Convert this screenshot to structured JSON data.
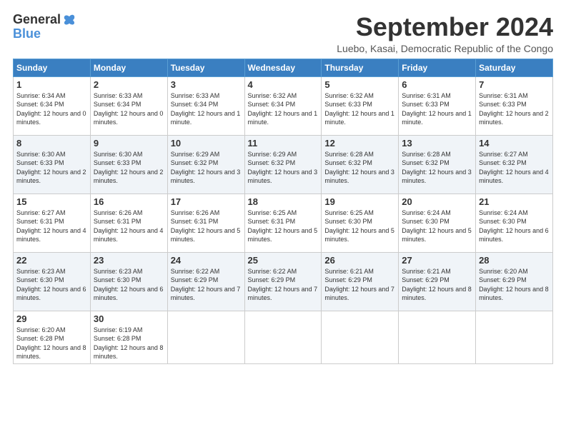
{
  "header": {
    "logo_general": "General",
    "logo_blue": "Blue",
    "month_title": "September 2024",
    "location": "Luebo, Kasai, Democratic Republic of the Congo"
  },
  "weekdays": [
    "Sunday",
    "Monday",
    "Tuesday",
    "Wednesday",
    "Thursday",
    "Friday",
    "Saturday"
  ],
  "weeks": [
    [
      {
        "day": "1",
        "sunrise": "6:34 AM",
        "sunset": "6:34 PM",
        "daylight": "12 hours and 0 minutes."
      },
      {
        "day": "2",
        "sunrise": "6:33 AM",
        "sunset": "6:34 PM",
        "daylight": "12 hours and 0 minutes."
      },
      {
        "day": "3",
        "sunrise": "6:33 AM",
        "sunset": "6:34 PM",
        "daylight": "12 hours and 1 minute."
      },
      {
        "day": "4",
        "sunrise": "6:32 AM",
        "sunset": "6:34 PM",
        "daylight": "12 hours and 1 minute."
      },
      {
        "day": "5",
        "sunrise": "6:32 AM",
        "sunset": "6:33 PM",
        "daylight": "12 hours and 1 minute."
      },
      {
        "day": "6",
        "sunrise": "6:31 AM",
        "sunset": "6:33 PM",
        "daylight": "12 hours and 1 minute."
      },
      {
        "day": "7",
        "sunrise": "6:31 AM",
        "sunset": "6:33 PM",
        "daylight": "12 hours and 2 minutes."
      }
    ],
    [
      {
        "day": "8",
        "sunrise": "6:30 AM",
        "sunset": "6:33 PM",
        "daylight": "12 hours and 2 minutes."
      },
      {
        "day": "9",
        "sunrise": "6:30 AM",
        "sunset": "6:33 PM",
        "daylight": "12 hours and 2 minutes."
      },
      {
        "day": "10",
        "sunrise": "6:29 AM",
        "sunset": "6:32 PM",
        "daylight": "12 hours and 3 minutes."
      },
      {
        "day": "11",
        "sunrise": "6:29 AM",
        "sunset": "6:32 PM",
        "daylight": "12 hours and 3 minutes."
      },
      {
        "day": "12",
        "sunrise": "6:28 AM",
        "sunset": "6:32 PM",
        "daylight": "12 hours and 3 minutes."
      },
      {
        "day": "13",
        "sunrise": "6:28 AM",
        "sunset": "6:32 PM",
        "daylight": "12 hours and 3 minutes."
      },
      {
        "day": "14",
        "sunrise": "6:27 AM",
        "sunset": "6:32 PM",
        "daylight": "12 hours and 4 minutes."
      }
    ],
    [
      {
        "day": "15",
        "sunrise": "6:27 AM",
        "sunset": "6:31 PM",
        "daylight": "12 hours and 4 minutes."
      },
      {
        "day": "16",
        "sunrise": "6:26 AM",
        "sunset": "6:31 PM",
        "daylight": "12 hours and 4 minutes."
      },
      {
        "day": "17",
        "sunrise": "6:26 AM",
        "sunset": "6:31 PM",
        "daylight": "12 hours and 5 minutes."
      },
      {
        "day": "18",
        "sunrise": "6:25 AM",
        "sunset": "6:31 PM",
        "daylight": "12 hours and 5 minutes."
      },
      {
        "day": "19",
        "sunrise": "6:25 AM",
        "sunset": "6:30 PM",
        "daylight": "12 hours and 5 minutes."
      },
      {
        "day": "20",
        "sunrise": "6:24 AM",
        "sunset": "6:30 PM",
        "daylight": "12 hours and 5 minutes."
      },
      {
        "day": "21",
        "sunrise": "6:24 AM",
        "sunset": "6:30 PM",
        "daylight": "12 hours and 6 minutes."
      }
    ],
    [
      {
        "day": "22",
        "sunrise": "6:23 AM",
        "sunset": "6:30 PM",
        "daylight": "12 hours and 6 minutes."
      },
      {
        "day": "23",
        "sunrise": "6:23 AM",
        "sunset": "6:30 PM",
        "daylight": "12 hours and 6 minutes."
      },
      {
        "day": "24",
        "sunrise": "6:22 AM",
        "sunset": "6:29 PM",
        "daylight": "12 hours and 7 minutes."
      },
      {
        "day": "25",
        "sunrise": "6:22 AM",
        "sunset": "6:29 PM",
        "daylight": "12 hours and 7 minutes."
      },
      {
        "day": "26",
        "sunrise": "6:21 AM",
        "sunset": "6:29 PM",
        "daylight": "12 hours and 7 minutes."
      },
      {
        "day": "27",
        "sunrise": "6:21 AM",
        "sunset": "6:29 PM",
        "daylight": "12 hours and 8 minutes."
      },
      {
        "day": "28",
        "sunrise": "6:20 AM",
        "sunset": "6:29 PM",
        "daylight": "12 hours and 8 minutes."
      }
    ],
    [
      {
        "day": "29",
        "sunrise": "6:20 AM",
        "sunset": "6:28 PM",
        "daylight": "12 hours and 8 minutes."
      },
      {
        "day": "30",
        "sunrise": "6:19 AM",
        "sunset": "6:28 PM",
        "daylight": "12 hours and 8 minutes."
      },
      null,
      null,
      null,
      null,
      null
    ]
  ]
}
